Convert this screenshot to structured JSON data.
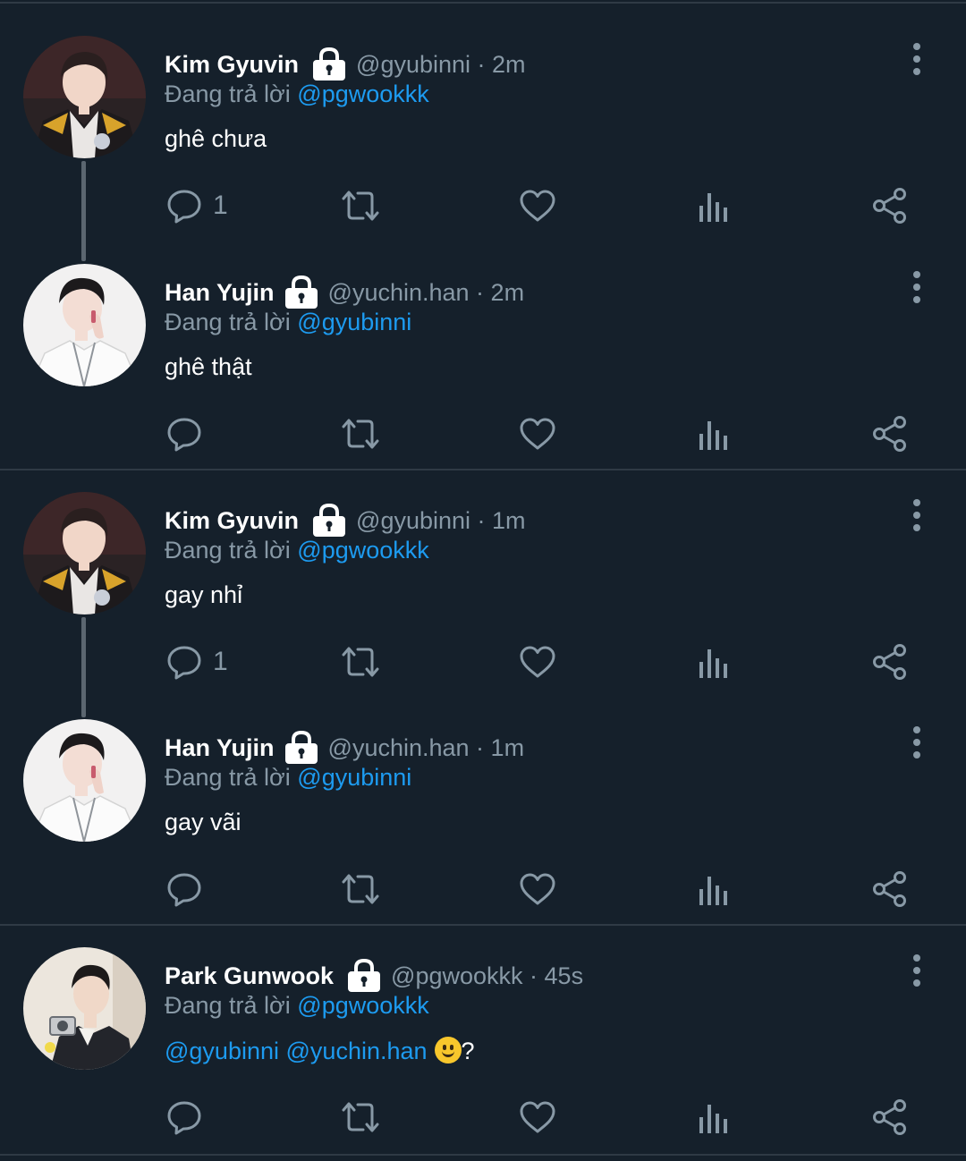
{
  "colors": {
    "background": "#15202b",
    "divider": "#2f3a45",
    "muted": "#8899a6",
    "mention": "#1d9bf0",
    "text": "#ffffff"
  },
  "icons": {
    "protected": "lock-icon",
    "reply": "reply-icon",
    "retweet": "retweet-icon",
    "like": "heart-icon",
    "views": "analytics-icon",
    "share": "share-icon",
    "more": "more-vertical-icon"
  },
  "tweets": [
    {
      "name": "Kim Gyuvin",
      "handle": "@gyubinni",
      "time": "2m",
      "reply_prefix": "Đang trả lời",
      "reply_to": "@pgwookkk",
      "text": "ghê chưa",
      "reply_count": "1"
    },
    {
      "name": "Han Yujin",
      "handle": "@yuchin.han",
      "time": "2m",
      "reply_prefix": "Đang trả lời",
      "reply_to": "@gyubinni",
      "text": "ghê thật",
      "reply_count": ""
    },
    {
      "name": "Kim Gyuvin",
      "handle": "@gyubinni",
      "time": "1m",
      "reply_prefix": "Đang trả lời",
      "reply_to": "@pgwookkk",
      "text": "gay nhỉ",
      "reply_count": "1"
    },
    {
      "name": "Han Yujin",
      "handle": "@yuchin.han",
      "time": "1m",
      "reply_prefix": "Đang trả lời",
      "reply_to": "@gyubinni",
      "text": "gay vãi",
      "reply_count": ""
    },
    {
      "name": "Park Gunwook",
      "handle": "@pgwookkk",
      "time": "45s",
      "reply_prefix": "Đang trả lời",
      "reply_to": "@pgwookkk",
      "text_mention_1": "@gyubinni",
      "text_mention_2": "@yuchin.han",
      "text_suffix": "?",
      "reply_count": ""
    }
  ]
}
